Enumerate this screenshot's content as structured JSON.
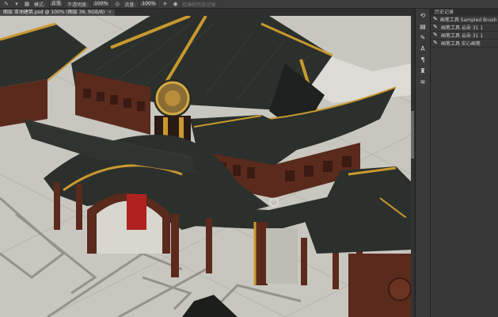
{
  "options_bar": {
    "mode_label": "模式:",
    "mode_value": "正常",
    "opacity_label": "不透明度:",
    "opacity_value": "100%",
    "flow_label": "流量:",
    "flow_value": "100%",
    "history_label": "绘画的历史记录"
  },
  "document_tab": {
    "title": "图层 亚洲建筑.psd @ 100% (图层 36, RGB/8)",
    "close": "×"
  },
  "history_panel": {
    "title": "历史记录",
    "items": [
      "画笔工具 Sampled Brush 1 1",
      "画笔工具 云朵 31 1",
      "画笔工具 云朵 31 1",
      "画笔工具 实心画笔"
    ]
  },
  "colors": {
    "roof": "#2b302c",
    "gold": "#c9982f",
    "wood": "#5a2a1c",
    "ground": "#c7c6bf",
    "ui_dark": "#383838"
  }
}
